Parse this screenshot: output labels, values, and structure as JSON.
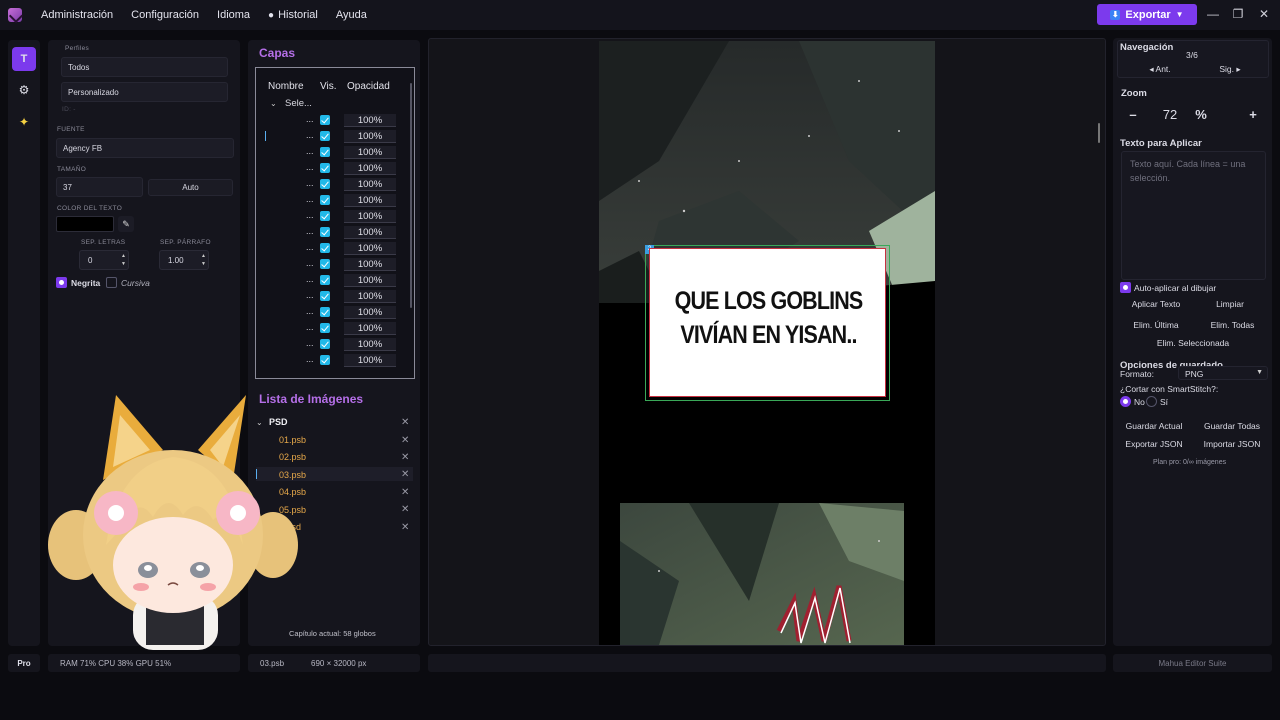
{
  "menu": [
    "Administración",
    "Configuración",
    "Idioma",
    "Historial",
    "Ayuda"
  ],
  "export_label": "Exportar",
  "window_controls": [
    "—",
    "❐",
    "✕"
  ],
  "tools": {
    "text": "T"
  },
  "props": {
    "profiles_label": "Perfiles",
    "profile_all": "Todos",
    "profile_custom": "Personalizado",
    "id_label": "ID: -",
    "font_label": "FUENTE",
    "font_value": "Agency FB",
    "size_label": "TAMAÑO",
    "size_value": "37",
    "auto_label": "Auto",
    "color_label": "COLOR DEL TEXTO",
    "letter_sep_label": "SEP. LETRAS",
    "letter_sep_value": "0",
    "para_sep_label": "SEP. PÁRRAFO",
    "para_sep_value": "1.00",
    "bold_label": "Negrita",
    "italic_label": "Cursiva",
    "bold_checked": true,
    "italic_checked": false
  },
  "layers": {
    "title": "Capas",
    "col_name": "Nombre",
    "col_vis": "Vis.",
    "col_opacity": "Opacidad",
    "group_name": "Sele...",
    "rows": [
      {
        "name": "...",
        "opacity": "100%"
      },
      {
        "name": "...",
        "opacity": "100%"
      },
      {
        "name": "...",
        "opacity": "100%"
      },
      {
        "name": "...",
        "opacity": "100%"
      },
      {
        "name": "...",
        "opacity": "100%"
      },
      {
        "name": "...",
        "opacity": "100%"
      },
      {
        "name": "...",
        "opacity": "100%"
      },
      {
        "name": "...",
        "opacity": "100%"
      },
      {
        "name": "...",
        "opacity": "100%"
      },
      {
        "name": "...",
        "opacity": "100%"
      },
      {
        "name": "...",
        "opacity": "100%"
      },
      {
        "name": "...",
        "opacity": "100%"
      },
      {
        "name": "...",
        "opacity": "100%"
      },
      {
        "name": "...",
        "opacity": "100%"
      },
      {
        "name": "...",
        "opacity": "100%"
      },
      {
        "name": "...",
        "opacity": "100%"
      }
    ]
  },
  "images": {
    "title": "Lista de Imágenes",
    "folder": "PSD",
    "files": [
      "01.psb",
      "02.psb",
      "03.psb",
      "04.psb",
      "05.psb",
      "...psd"
    ],
    "chapter_info": "Capítulo actual: 58 globos"
  },
  "canvas": {
    "bubble_line1": "QUE LOS GOBLINS",
    "bubble_line2": "VIVÍAN EN YISAN..",
    "bubble_badge": "2"
  },
  "right": {
    "nav_title": "Navegación",
    "nav_page": "3/6",
    "prev": "◂ Ant.",
    "next": "Sig. ▸",
    "zoom_title": "Zoom",
    "zoom_minus": "–",
    "zoom_value": "72",
    "zoom_unit": "%",
    "zoom_plus": "+",
    "text_title": "Texto para Aplicar",
    "text_placeholder": "Texto aquí. Cada línea = una selección.",
    "auto_apply": "Auto-aplicar al dibujar",
    "apply_text": "Aplicar Texto",
    "clear": "Limpiar",
    "del_last": "Elim. Última",
    "del_all": "Elim. Todas",
    "del_selected": "Elim. Seleccionada",
    "save_opts_title": "Opciones de guardado",
    "format_label": "Formato:",
    "format_value": "PNG",
    "cut_label": "¿Cortar con SmartStitch?:",
    "no_label": "No",
    "yes_label": "Sí",
    "save_current": "Guardar Actual",
    "save_all": "Guardar Todas",
    "export_json": "Exportar JSON",
    "import_json": "Importar JSON",
    "plan": "Plan pro: 0/∞ imágenes"
  },
  "status": {
    "pro": "Pro",
    "stats": "RAM 71%  CPU 38%  GPU 51%",
    "file": "03.psb",
    "dims": "690 × 32000 px",
    "suite": "Mahua Editor Suite"
  },
  "colors": {
    "accent": "#7c3aed",
    "title": "#b56fe8",
    "file": "#e6a84a",
    "check": "#22b8e8"
  }
}
